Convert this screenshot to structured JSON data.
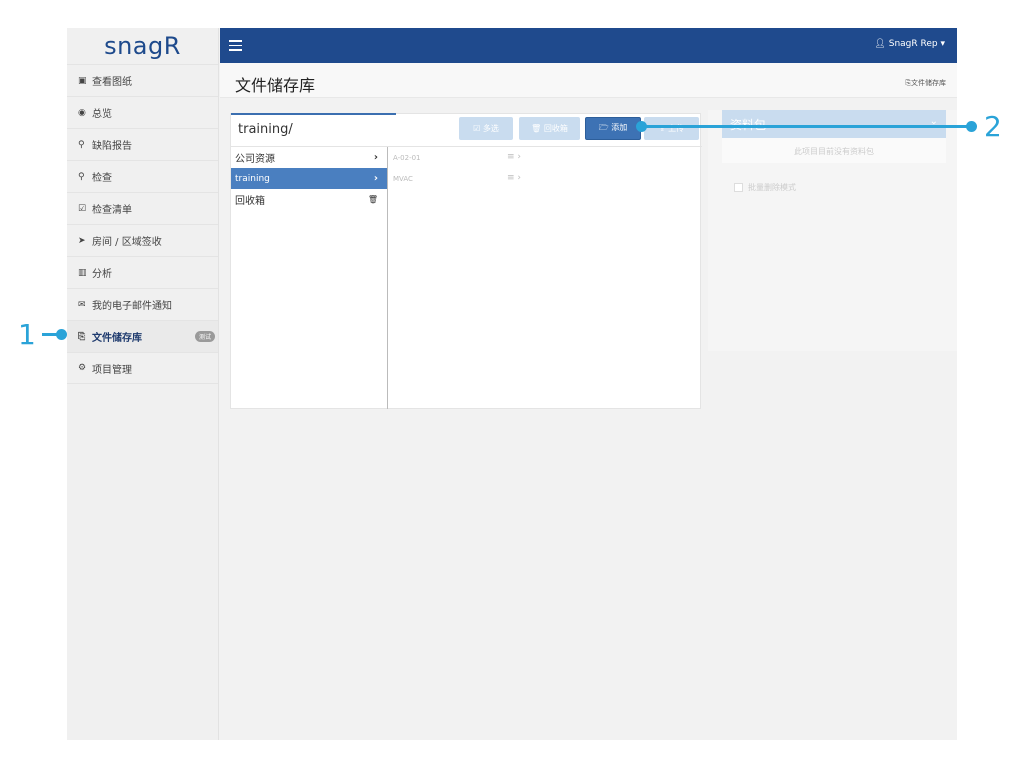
{
  "logo": "snagR",
  "topbar": {
    "user": "SnagR Rep ▾"
  },
  "sidebar": {
    "items": [
      {
        "label": "查看图纸",
        "icon": "▣",
        "icon_name": "image-icon"
      },
      {
        "label": "总览",
        "icon": "◉",
        "icon_name": "dashboard-icon"
      },
      {
        "label": "缺陷报告",
        "icon": "⚲",
        "icon_name": "map-marker-icon"
      },
      {
        "label": "检查",
        "icon": "⚲",
        "icon_name": "search-icon"
      },
      {
        "label": "检查清单",
        "icon": "☑",
        "icon_name": "checklist-icon"
      },
      {
        "label": "房间 / 区域签收",
        "icon": "➤",
        "icon_name": "location-arrow-icon"
      },
      {
        "label": "分析",
        "icon": "▥",
        "icon_name": "bar-chart-icon"
      },
      {
        "label": "我的电子邮件通知",
        "icon": "✉",
        "icon_name": "envelope-icon"
      },
      {
        "label": "文件储存库",
        "icon": "⎘",
        "icon_name": "copy-icon",
        "badge": "测试"
      },
      {
        "label": "项目管理",
        "icon": "⚙",
        "icon_name": "cogs-icon"
      }
    ]
  },
  "page": {
    "title": "文件储存库",
    "breadcrumb": "⎘文件储存库"
  },
  "files": {
    "path": "training/",
    "toolbar": {
      "multi": "☑ 多选",
      "trash": "🗑 回收箱",
      "add": "🗁 添加",
      "upload": "⇪ 上传"
    },
    "folders": [
      {
        "name": "公司资源",
        "marker": "›"
      },
      {
        "name": "training",
        "marker": "›"
      },
      {
        "name": "回收箱",
        "marker": "🗑"
      }
    ],
    "items": [
      {
        "name": "A-02-01",
        "controls": "≡ ›"
      },
      {
        "name": "MVAC",
        "controls": "≡ ›"
      }
    ]
  },
  "package": {
    "title": "资料包",
    "empty": "此项目目前没有资料包",
    "bulk_delete": "批量删除模式"
  },
  "callouts": {
    "one": "1",
    "two": "2"
  },
  "colors": {
    "topbar": "#1f4a8d",
    "accent": "#3d72b4",
    "callout": "#2aa3d8"
  }
}
